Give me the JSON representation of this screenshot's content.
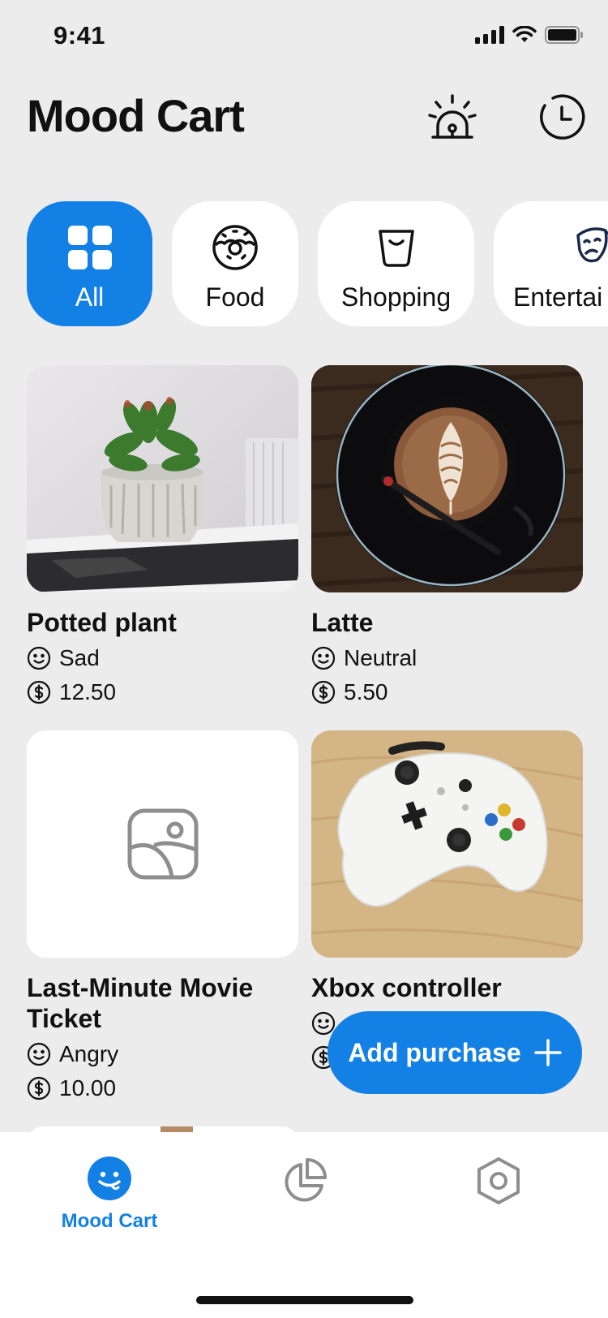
{
  "status_bar": {
    "time": "9:41"
  },
  "header": {
    "title": "Mood Cart",
    "alarm_icon": "alarm-light-icon",
    "history_icon": "clock-icon"
  },
  "categories": [
    {
      "label": "All",
      "icon": "grid-icon",
      "active": true
    },
    {
      "label": "Food",
      "icon": "donut-icon",
      "active": false
    },
    {
      "label": "Shopping",
      "icon": "shopping-bag-icon",
      "active": false
    },
    {
      "label": "Entertai",
      "icon": "theater-masks-icon",
      "active": false
    }
  ],
  "purchases": [
    {
      "name": "Potted plant",
      "mood": "Sad",
      "price": "12.50",
      "image": "potted-plant-photo"
    },
    {
      "name": "Latte",
      "mood": "Neutral",
      "price": "5.50",
      "image": "latte-photo"
    },
    {
      "name": "Last-Minute Movie Ticket",
      "mood": "Angry",
      "price": "10.00",
      "image": "placeholder-image"
    },
    {
      "name": "Xbox controller",
      "mood": "",
      "price": "",
      "image": "controller-photo"
    }
  ],
  "fab": {
    "label": "Add purchase"
  },
  "tab_bar": {
    "tabs": [
      {
        "label": "Mood Cart",
        "icon": "smiley-icon",
        "active": true
      },
      {
        "label": "",
        "icon": "pie-chart-icon",
        "active": false
      },
      {
        "label": "",
        "icon": "settings-hex-icon",
        "active": false
      }
    ]
  },
  "colors": {
    "accent": "#1380e6",
    "background": "#ececec",
    "card": "#ffffff",
    "icon_gray": "#8e8e8e"
  }
}
